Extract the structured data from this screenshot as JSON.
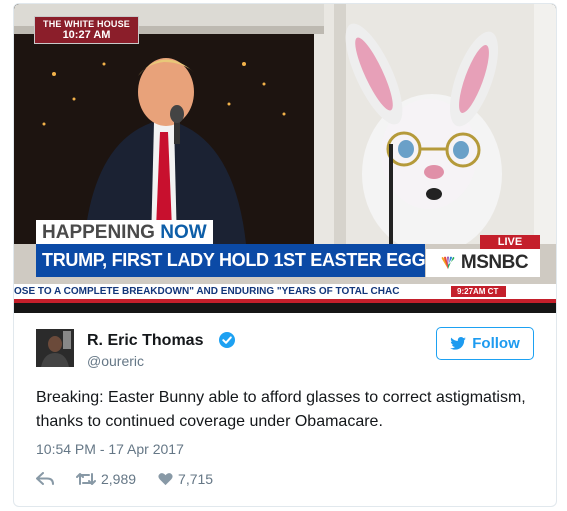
{
  "video": {
    "bug_line1": "THE WHITE HOUSE",
    "bug_line2": "10:27 AM",
    "happening_a": "HAPPENING",
    "happening_b": "NOW",
    "headline": "TRUMP, FIRST LADY HOLD 1ST EASTER EGG ROLL",
    "live": "LIVE",
    "network": "MSNBC",
    "ticker": "OSE TO A COMPLETE BREAKDOWN\" AND ENDURING \"YEARS OF TOTAL CHAC",
    "ticker_time": "9:27AM CT"
  },
  "author": {
    "name": "R. Eric Thomas",
    "handle": "@oureric",
    "verified": true
  },
  "follow_label": "Follow",
  "tweet_text": "Breaking: Easter Bunny able to afford glasses to correct astigmatism, thanks to continued coverage under Obamacare.",
  "timestamp": "10:54 PM - 17 Apr 2017",
  "retweets": "2,989",
  "likes": "7,715",
  "colors": {
    "accent": "#1da1f2",
    "headline_blue": "#0b4aa6",
    "live_red": "#c41f2b"
  }
}
